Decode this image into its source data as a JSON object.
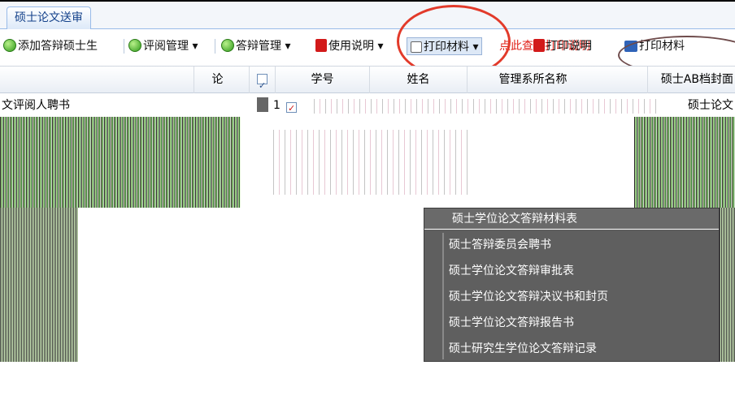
{
  "tab": {
    "label": "硕士论文送审"
  },
  "toolbar": {
    "items": [
      {
        "label": "添加答辩硕士生",
        "icon": "add-icon"
      },
      {
        "label": "评阅管理",
        "icon": "review-icon"
      },
      {
        "label": "答辩管理",
        "icon": "defense-icon"
      },
      {
        "label": "使用说明",
        "icon": "pdf-icon"
      },
      {
        "label": "打印材料",
        "icon": "print-icon"
      },
      {
        "label": "点此查看打印说明",
        "icon": ""
      },
      {
        "label": "打印说明",
        "icon": "pdf-icon"
      },
      {
        "label": "打印材料",
        "icon": "card-icon"
      }
    ],
    "accent": "#e0221a"
  },
  "grid": {
    "columns": [
      "论",
      "学号",
      "姓名",
      "管理系所名称",
      "硕士AB档封面"
    ],
    "row1": {
      "index": "1",
      "left_text": "文评阅人聘书",
      "right_text": "硕士论文"
    }
  },
  "menu": {
    "title": "硕士学位论文答辩材料表",
    "items": [
      "硕士答辩委员会聘书",
      "硕士学位论文答辩审批表",
      "硕士学位论文答辩决议书和封页",
      "硕士学位论文答辩报告书",
      "硕士研究生学位论文答辩记录"
    ]
  }
}
